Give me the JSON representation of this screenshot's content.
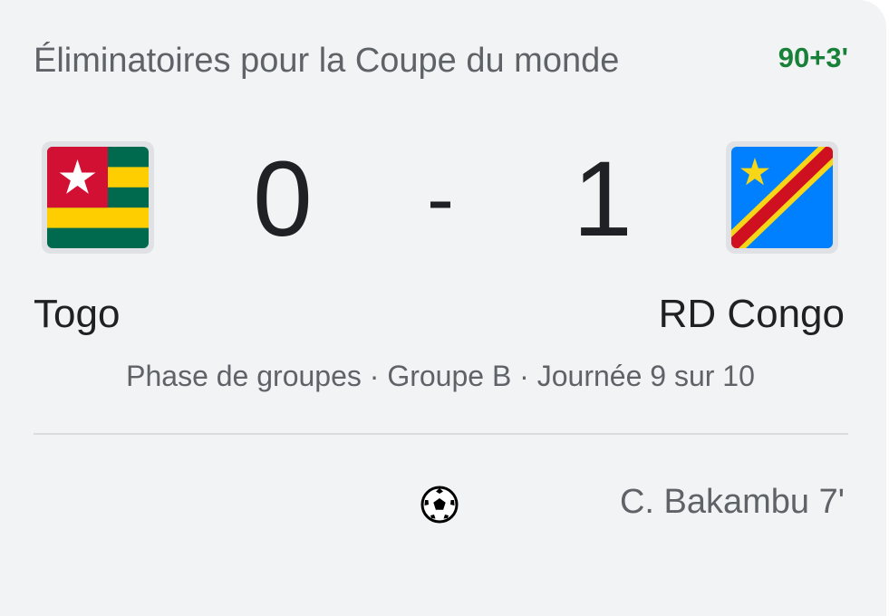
{
  "match": {
    "competition": "Éliminatoires pour la Coupe du monde",
    "status_time": "90+3'",
    "phase": "Phase de groupes · Groupe B · Journée 9 sur 10"
  },
  "home": {
    "name": "Togo",
    "score": "0",
    "flag_icon": "togo-flag"
  },
  "away": {
    "name": "RD Congo",
    "score": "1",
    "flag_icon": "dr-congo-flag"
  },
  "score_separator": "-",
  "events": [
    {
      "icon": "soccer-ball-icon",
      "text": "C. Bakambu 7'"
    }
  ],
  "colors": {
    "live_green": "#188038",
    "text_primary": "#202124",
    "text_secondary": "#5f6368",
    "card_bg": "#f1f3f4"
  }
}
